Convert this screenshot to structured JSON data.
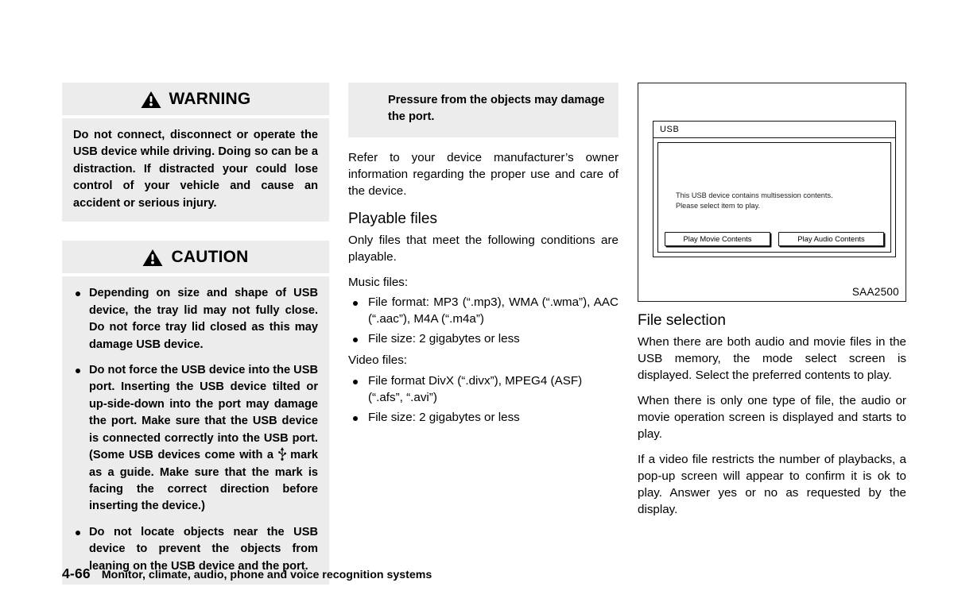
{
  "page": {
    "number": "4-66",
    "footer_title": "Monitor, climate, audio, phone and voice recognition systems"
  },
  "column1": {
    "warning": {
      "icon": "warning-triangle-icon",
      "label": "WARNING",
      "text": "Do not connect, disconnect or operate the USB device while driving. Doing so can be a distraction. If distracted your could lose control of your vehicle and cause an accident or serious injury."
    },
    "caution": {
      "icon": "warning-triangle-icon",
      "label": "CAUTION",
      "bullets": [
        "Depending on size and shape of USB device, the tray lid may not fully close. Do not force tray lid closed as this may damage USB device.",
        "Do not force the USB device into the USB port. Inserting the USB device tilted or up-side-down into the port may damage the port. Make sure that the USB device is connected correctly into the USB port. (Some USB devices come with a ",
        "Do not locate objects near the USB device to prevent the objects from leaning on the USB device and the port."
      ],
      "bullet2_continuation": "mark as a guide. Make sure that the mark is facing the correct direction before inserting the device.)",
      "usb_mark_icon": "usb-trident-icon"
    }
  },
  "column2": {
    "caution_continued": "Pressure from the objects may damage the port.",
    "paragraph1": "Refer to your device manufacturer’s owner information regarding the proper use and care of the device.",
    "playable_heading": "Playable files",
    "playable_intro": "Only files that meet the following conditions are playable.",
    "music_label": "Music files:",
    "music_bullets": [
      "File format: MP3 (“.mp3), WMA (“.wma”), AAC (“.aac”), M4A (“.m4a”)",
      "File size: 2 gigabytes or less"
    ],
    "video_label": "Video files:",
    "video_bullets": [
      "File format DivX (“.divx”), MPEG4 (ASF) (“.afs”, “.avi”)",
      "File size: 2 gigabytes or less"
    ]
  },
  "column3": {
    "figure": {
      "screen_title": "USB",
      "message_line1": "This USB device contains multisession contents.",
      "message_line2": "Please select item to play.",
      "button_movie": "Play Movie Contents",
      "button_audio": "Play Audio Contents",
      "code": "SAA2500"
    },
    "heading": "File selection",
    "paragraphs": [
      "When there are both audio and movie files in the USB memory, the mode select screen is displayed. Select the preferred contents to play.",
      "When there is only one type of file, the audio or movie operation screen is displayed and starts to play.",
      "If a video file restricts the number of playbacks, a pop-up screen will appear to confirm it is ok to play. Answer yes or no as requested by the display."
    ]
  }
}
